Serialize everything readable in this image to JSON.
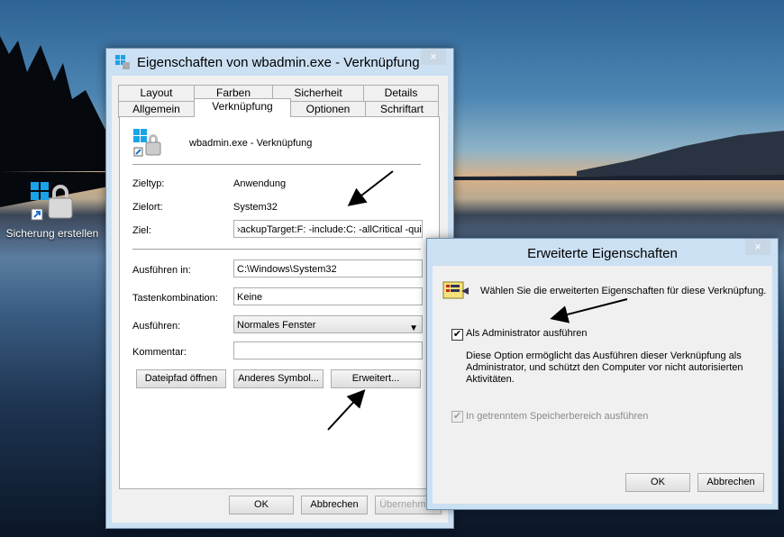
{
  "desktop": {
    "icon_label": "Sicherung erstellen"
  },
  "props_window": {
    "title": "Eigenschaften von wbadmin.exe - Verknüpfung",
    "close": "×",
    "tabs_row1": [
      "Layout",
      "Farben",
      "Sicherheit",
      "Details"
    ],
    "tabs_row2": [
      "Allgemein",
      "Verknüpfung",
      "Optionen",
      "Schriftart"
    ],
    "header_name": "wbadmin.exe - Verknüpfung",
    "zieltyp_label": "Zieltyp:",
    "zieltyp_value": "Anwendung",
    "zielort_label": "Zielort:",
    "zielort_value": "System32",
    "ziel_label": "Ziel:",
    "ziel_value": "›ackupTarget:F: -include:C: -allCritical -quiet",
    "ausfuehren_in_label": "Ausführen in:",
    "ausfuehren_in_value": "C:\\Windows\\System32",
    "tasten_label": "Tastenkombination:",
    "tasten_value": "Keine",
    "ausfuehren_label": "Ausführen:",
    "ausfuehren_value": "Normales Fenster",
    "kommentar_label": "Kommentar:",
    "kommentar_value": "",
    "btn_dateipfad": "Dateipfad öffnen",
    "btn_symbol": "Anderes Symbol...",
    "btn_erweitert": "Erweitert...",
    "btn_ok": "OK",
    "btn_abbrechen": "Abbrechen",
    "btn_uebernehmen": "Übernehmen"
  },
  "adv_window": {
    "title": "Erweiterte Eigenschaften",
    "close": "×",
    "intro": "Wählen Sie die erweiterten Eigenschaften für diese Verknüpfung.",
    "admin_label": "Als Administrator ausführen",
    "admin_checked": true,
    "description": "Diese Option ermöglicht das Ausführen dieser Verknüpfung als Administrator, und schützt den Computer vor nicht autorisierten Aktivitäten.",
    "separate_label": "In getrenntem Speicherbereich ausführen",
    "separate_checked": true,
    "btn_ok": "OK",
    "btn_abbrechen": "Abbrechen",
    "check_mark": "✔"
  }
}
